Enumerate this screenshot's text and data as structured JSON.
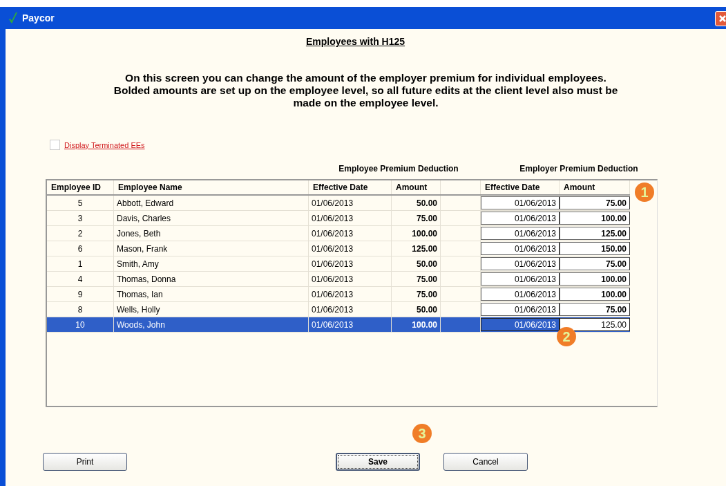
{
  "window": {
    "title": "Paycor"
  },
  "heading": "Employees with H125",
  "instructions": "On this screen you can change the amount of the employer premium for individual employees. Bolded amounts are set up on the employee level, so all future edits at the client level also must be made on the employee level.",
  "display_terminated": {
    "label": "Display Terminated EEs",
    "checked": false
  },
  "group_headings": [
    "Employee Premium Deduction",
    "Employer Premium Deduction"
  ],
  "table": {
    "columns": [
      "Employee ID",
      "Employee Name",
      "Effective Date",
      "Amount",
      "Effective Date",
      "Amount"
    ],
    "rows": [
      {
        "id": "5",
        "name": "Abbott, Edward",
        "ee_date": "01/06/2013",
        "ee_amount": "50.00",
        "er_date": "01/06/2013",
        "er_amount": "75.00",
        "er_bold": true,
        "selected": false
      },
      {
        "id": "3",
        "name": "Davis, Charles",
        "ee_date": "01/06/2013",
        "ee_amount": "75.00",
        "er_date": "01/06/2013",
        "er_amount": "100.00",
        "er_bold": true,
        "selected": false
      },
      {
        "id": "2",
        "name": "Jones, Beth",
        "ee_date": "01/06/2013",
        "ee_amount": "100.00",
        "er_date": "01/06/2013",
        "er_amount": "125.00",
        "er_bold": true,
        "selected": false
      },
      {
        "id": "6",
        "name": "Mason, Frank",
        "ee_date": "01/06/2013",
        "ee_amount": "125.00",
        "er_date": "01/06/2013",
        "er_amount": "150.00",
        "er_bold": true,
        "selected": false
      },
      {
        "id": "1",
        "name": "Smith, Amy",
        "ee_date": "01/06/2013",
        "ee_amount": "50.00",
        "er_date": "01/06/2013",
        "er_amount": "75.00",
        "er_bold": true,
        "selected": false
      },
      {
        "id": "4",
        "name": "Thomas, Donna",
        "ee_date": "01/06/2013",
        "ee_amount": "75.00",
        "er_date": "01/06/2013",
        "er_amount": "100.00",
        "er_bold": true,
        "selected": false
      },
      {
        "id": "9",
        "name": "Thomas, Ian",
        "ee_date": "01/06/2013",
        "ee_amount": "75.00",
        "er_date": "01/06/2013",
        "er_amount": "100.00",
        "er_bold": true,
        "selected": false
      },
      {
        "id": "8",
        "name": "Wells, Holly",
        "ee_date": "01/06/2013",
        "ee_amount": "50.00",
        "er_date": "01/06/2013",
        "er_amount": "75.00",
        "er_bold": true,
        "selected": false
      },
      {
        "id": "10",
        "name": "Woods, John",
        "ee_date": "01/06/2013",
        "ee_amount": "100.00",
        "er_date": "01/06/2013",
        "er_amount": "125.00",
        "er_bold": false,
        "selected": true
      }
    ]
  },
  "buttons": [
    {
      "label": "Print",
      "kind": "normal"
    },
    {
      "label": "Save",
      "kind": "default"
    },
    {
      "label": "Cancel",
      "kind": "normal"
    }
  ],
  "callouts": [
    "1",
    "2",
    "3"
  ]
}
